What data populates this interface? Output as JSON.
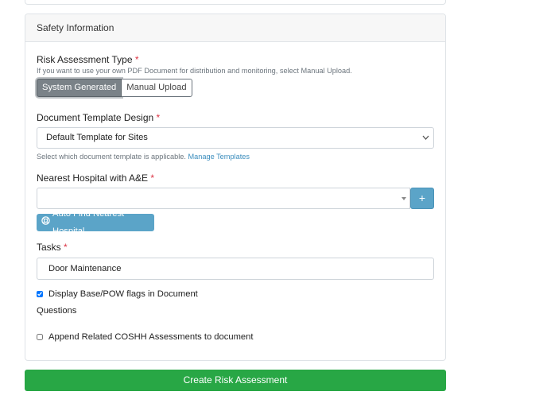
{
  "card": {
    "header": "Safety Information"
  },
  "risk_type": {
    "label": "Risk Assessment Type",
    "required": "*",
    "help": "If you want to use your own PDF Document for distribution and monitoring, select Manual Upload.",
    "options": [
      "System Generated",
      "Manual Upload"
    ],
    "selected": "System Generated"
  },
  "template": {
    "label": "Document Template Design",
    "required": "*",
    "value": "Default Template for Sites",
    "help": "Select which document template is applicable.",
    "help_link": "Manage Templates"
  },
  "hospital": {
    "label": "Nearest Hospital with A&E",
    "required": "*",
    "value": "",
    "add_label": "+",
    "auto_find_label": "Auto Find Nearest Hospital"
  },
  "tasks": {
    "label": "Tasks",
    "required": "*",
    "value": "Door Maintenance"
  },
  "display_flags": {
    "label": "Display Base/POW flags in Document",
    "checked": true
  },
  "questions": {
    "label": "Questions"
  },
  "append_coshh": {
    "label": "Append Related COSHH Assessments to document",
    "checked": false
  },
  "submit": {
    "label": "Create Risk Assessment"
  },
  "colors": {
    "primary_info": "#5ba4c8",
    "success": "#28a745",
    "required": "#dc3545",
    "link": "#3b8dbd"
  }
}
